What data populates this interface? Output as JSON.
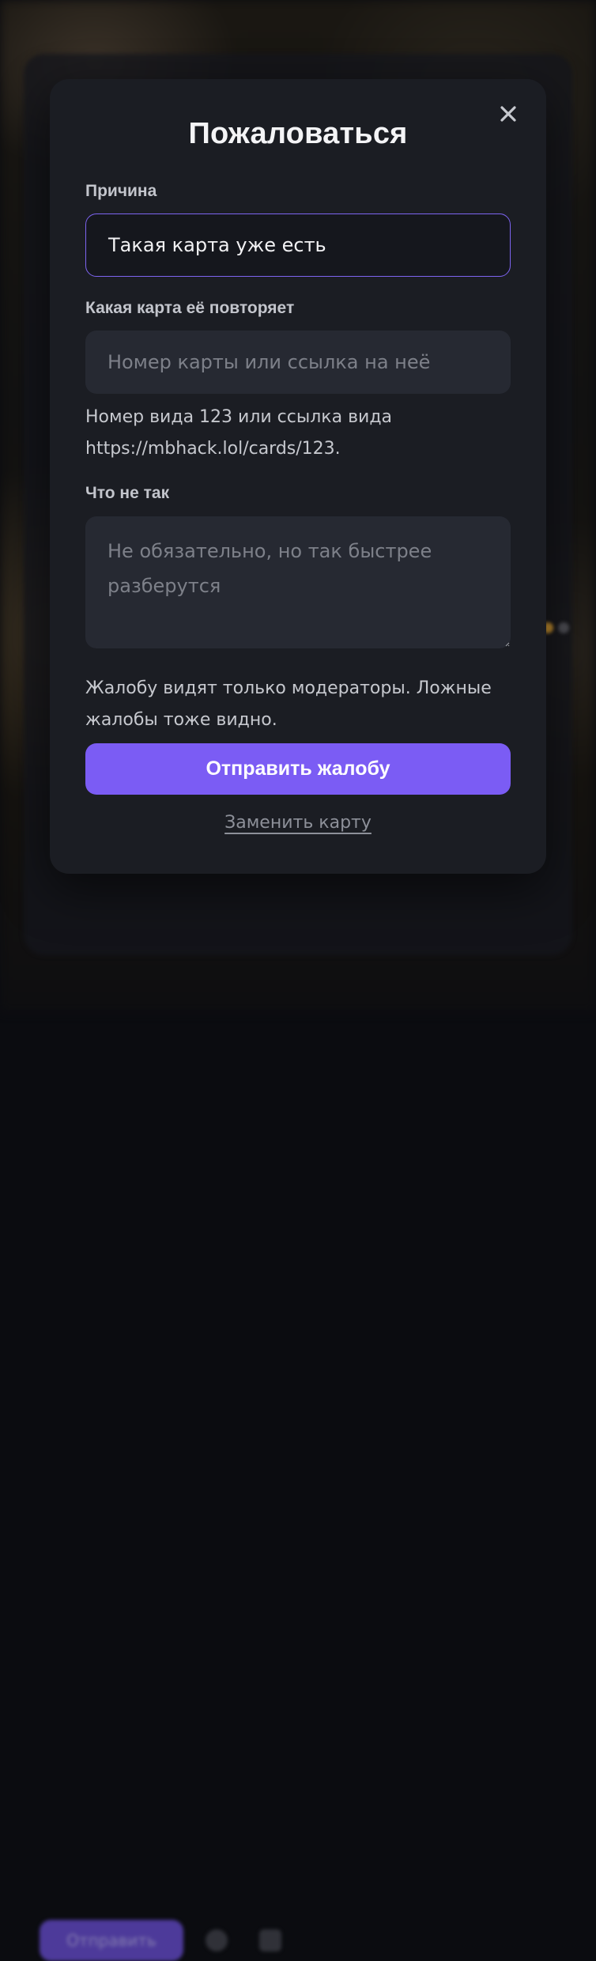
{
  "background": {
    "send_label": "Отправить"
  },
  "modal": {
    "title": "Пожаловаться",
    "reason": {
      "label": "Причина",
      "value": "Такая карта уже есть"
    },
    "duplicate": {
      "label": "Какая карта её повторяет",
      "placeholder": "Номер карты или ссылка на неё",
      "hint_line1": "Номер вида 123 или ссылка вида",
      "hint_line2": "https://mbhack.lol/cards/123."
    },
    "details": {
      "label": "Что не так",
      "placeholder_line1": "Не обязательно, но так быстрее",
      "placeholder_line2": "разберутся"
    },
    "notice_line1": "Жалобу видят только модераторы. Ложные",
    "notice_line2": "жалобы тоже видно.",
    "submit_label": "Отправить жалобу",
    "replace_label": "Заменить карту"
  },
  "colors": {
    "accent": "#7b5cf4",
    "modal_bg": "#1b1d23",
    "field_bg": "#262932"
  }
}
